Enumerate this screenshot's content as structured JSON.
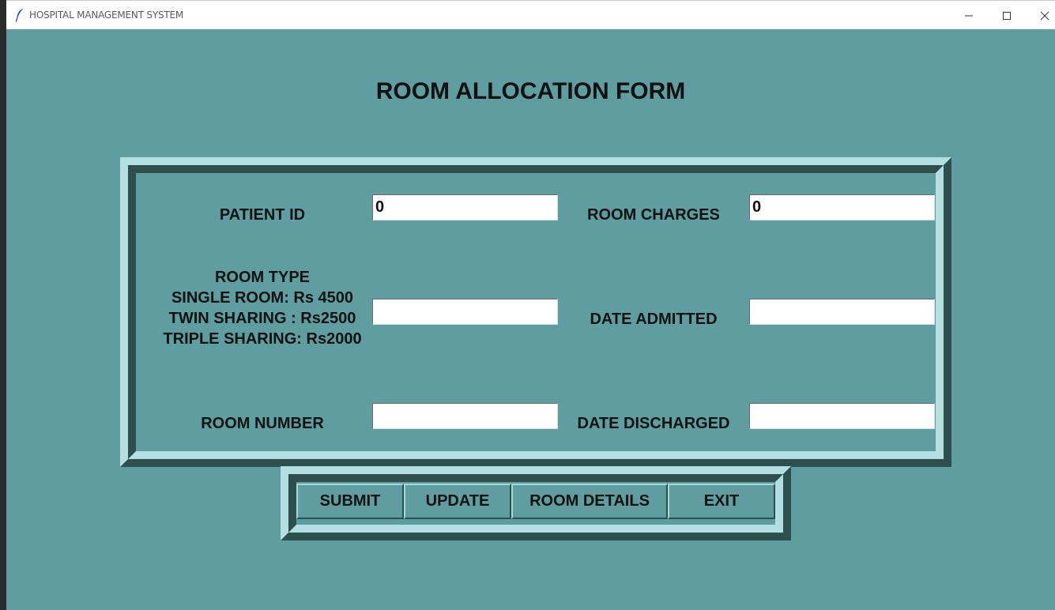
{
  "window": {
    "title": "HOSPITAL MANAGEMENT SYSTEM",
    "icon": "feather-icon",
    "controls": [
      "minimize-icon",
      "maximize-icon",
      "close-icon"
    ]
  },
  "form": {
    "title": "ROOM ALLOCATION FORM",
    "fields": {
      "patient_id": {
        "label": "PATIENT ID",
        "value": "0"
      },
      "room_charges": {
        "label": "ROOM CHARGES",
        "value": "0"
      },
      "room_type": {
        "label_lines": [
          "ROOM TYPE",
          "SINGLE ROOM: Rs 4500",
          "TWIN SHARING : Rs2500",
          "TRIPLE SHARING: Rs2000"
        ],
        "value": ""
      },
      "date_admitted": {
        "label": "DATE ADMITTED",
        "value": ""
      },
      "room_number": {
        "label": "ROOM NUMBER",
        "value": ""
      },
      "date_discharged": {
        "label": "DATE DISCHARGED",
        "value": ""
      }
    }
  },
  "buttons": {
    "submit": "SUBMIT",
    "update": "UPDATE",
    "room_details": "ROOM DETAILS",
    "exit": "EXIT"
  },
  "colors": {
    "background": "#5f9ea0",
    "frame_light": "#b2e0e2",
    "frame_dark": "#2f4f4f"
  }
}
